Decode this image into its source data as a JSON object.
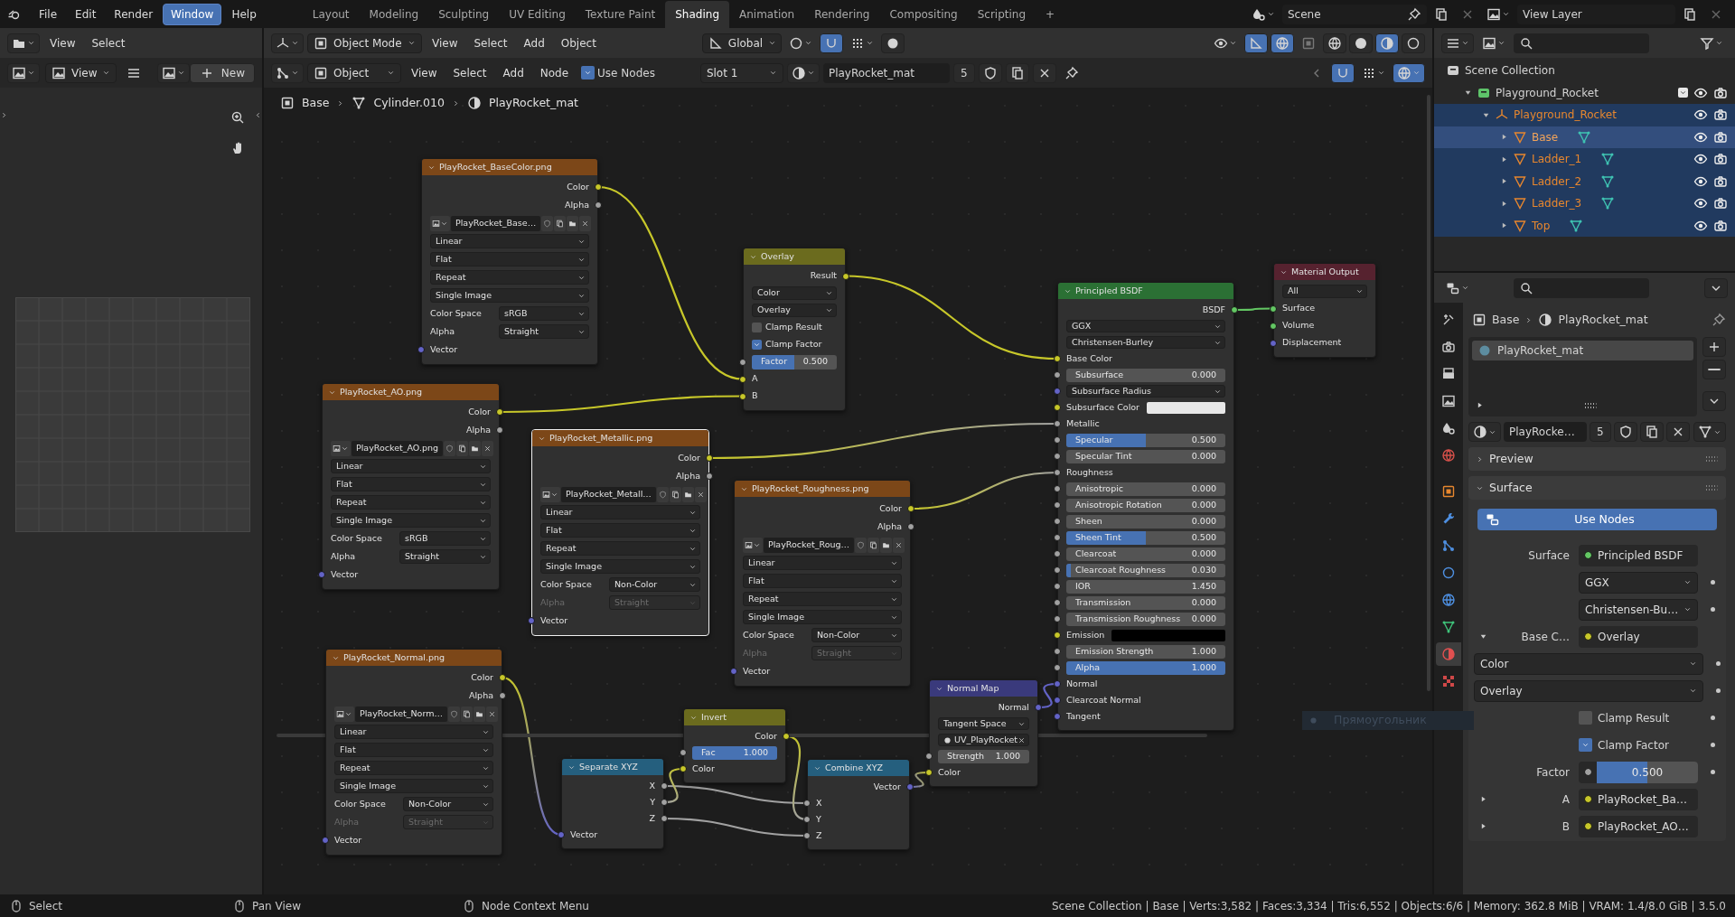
{
  "menu_bar": [
    {
      "label": "File",
      "selected": false
    },
    {
      "label": "Edit",
      "selected": false
    },
    {
      "label": "Render",
      "selected": false
    },
    {
      "label": "Window",
      "selected": true
    },
    {
      "label": "Help",
      "selected": false
    }
  ],
  "workspace_tabs": [
    {
      "label": "Layout",
      "selected": false
    },
    {
      "label": "Modeling",
      "selected": false
    },
    {
      "label": "Sculpting",
      "selected": false
    },
    {
      "label": "UV Editing",
      "selected": false
    },
    {
      "label": "Texture Paint",
      "selected": false
    },
    {
      "label": "Shading",
      "selected": true
    },
    {
      "label": "Animation",
      "selected": false
    },
    {
      "label": "Rendering",
      "selected": false
    },
    {
      "label": "Compositing",
      "selected": false
    },
    {
      "label": "Scripting",
      "selected": false
    }
  ],
  "add_workspace": "+",
  "scene": "Scene",
  "view_layer": "View Layer",
  "image_editor": {
    "menus": [
      "View",
      "Select"
    ],
    "view_menu": "View",
    "new_button": "New"
  },
  "viewport_header": {
    "mode": "Object Mode",
    "menus": [
      "View",
      "Select",
      "Add",
      "Object"
    ],
    "orientation": "Global"
  },
  "node_header": {
    "type": "Object",
    "menus": [
      "View",
      "Select",
      "Add",
      "Node"
    ],
    "use_nodes": {
      "label": "Use Nodes",
      "checked": true
    },
    "slot": "Slot 1",
    "material": "PlayRocket_mat",
    "users": "5"
  },
  "breadcrumb": [
    "Base",
    "Cylinder.010",
    "PlayRocket_mat"
  ],
  "nodes": [
    {
      "kind": "texture",
      "title": "PlayRocket_BaseColor.png",
      "selected": false,
      "rows": [
        {
          "kind": "output",
          "label": "Color",
          "color": "#c7c729"
        },
        {
          "kind": "output",
          "label": "Alpha",
          "color": "#a1a1a1"
        },
        {
          "kind": "image",
          "value": "PlayRocket_Base…"
        },
        {
          "kind": "select",
          "value": "Linear"
        },
        {
          "kind": "select",
          "value": "Flat"
        },
        {
          "kind": "select",
          "value": "Repeat"
        },
        {
          "kind": "select",
          "value": "Single Image"
        },
        {
          "kind": "prop",
          "label": "Color Space",
          "value": "sRGB",
          "disabled": false
        },
        {
          "kind": "prop",
          "label": "Alpha",
          "value": "Straight",
          "disabled": false
        },
        {
          "kind": "input",
          "label": "Vector",
          "color": "#6363c7"
        }
      ]
    },
    {
      "kind": "color",
      "title": "Overlay",
      "selected": false,
      "rows": [
        {
          "kind": "output",
          "label": "Result",
          "color": "#c7c729"
        },
        {
          "kind": "select",
          "value": "Color"
        },
        {
          "kind": "select",
          "value": "Overlay"
        },
        {
          "kind": "check",
          "label": "Clamp Result",
          "checked": false
        },
        {
          "kind": "check",
          "label": "Clamp Factor",
          "checked": true
        },
        {
          "kind": "slider",
          "label": "Factor",
          "value": "0.500",
          "level": 0.5,
          "color": "#a1a1a1"
        },
        {
          "kind": "input",
          "label": "A",
          "color": "#c7c729"
        },
        {
          "kind": "input",
          "label": "B",
          "color": "#c7c729"
        }
      ]
    },
    {
      "kind": "shader",
      "title": "Principled BSDF",
      "selected": false,
      "rows": [
        {
          "kind": "output",
          "label": "BSDF",
          "color": "#63c763"
        },
        {
          "kind": "select",
          "value": "GGX"
        },
        {
          "kind": "select",
          "value": "Christensen-Burley"
        },
        {
          "kind": "input",
          "label": "Base Color",
          "color": "#c7c729"
        },
        {
          "kind": "number",
          "label": "Subsurface",
          "value": "0.000",
          "color": "#a1a1a1"
        },
        {
          "kind": "select",
          "value": "Subsurface Radius",
          "color": "#6363c7"
        },
        {
          "kind": "color",
          "label": "Subsurface Color",
          "swatch": {
            "color": "#e8e8e8"
          },
          "color": "#c7c729"
        },
        {
          "kind": "input",
          "label": "Metallic",
          "color": "#a1a1a1"
        },
        {
          "kind": "slider",
          "label": "Specular",
          "value": "0.500",
          "level": 0.5,
          "color": "#a1a1a1"
        },
        {
          "kind": "number",
          "label": "Specular Tint",
          "value": "0.000",
          "color": "#a1a1a1"
        },
        {
          "kind": "input",
          "label": "Roughness",
          "color": "#a1a1a1"
        },
        {
          "kind": "number",
          "label": "Anisotropic",
          "value": "0.000",
          "color": "#a1a1a1"
        },
        {
          "kind": "number",
          "label": "Anisotropic Rotation",
          "value": "0.000",
          "color": "#a1a1a1"
        },
        {
          "kind": "number",
          "label": "Sheen",
          "value": "0.000",
          "color": "#a1a1a1"
        },
        {
          "kind": "slider",
          "label": "Sheen Tint",
          "value": "0.500",
          "level": 0.5,
          "color": "#a1a1a1"
        },
        {
          "kind": "number",
          "label": "Clearcoat",
          "value": "0.000",
          "color": "#a1a1a1"
        },
        {
          "kind": "slider",
          "label": "Clearcoat Roughness",
          "value": "0.030",
          "level": 0.03,
          "color": "#a1a1a1"
        },
        {
          "kind": "number",
          "label": "IOR",
          "value": "1.450",
          "color": "#a1a1a1"
        },
        {
          "kind": "number",
          "label": "Transmission",
          "value": "0.000",
          "color": "#a1a1a1"
        },
        {
          "kind": "number",
          "label": "Transmission Roughness",
          "value": "0.000",
          "color": "#a1a1a1"
        },
        {
          "kind": "color",
          "label": "Emission",
          "swatch": {
            "color": "#000000"
          },
          "color": "#c7c729"
        },
        {
          "kind": "number",
          "label": "Emission Strength",
          "value": "1.000",
          "color": "#a1a1a1"
        },
        {
          "kind": "slider",
          "label": "Alpha",
          "value": "1.000",
          "level": 1,
          "color": "#a1a1a1"
        },
        {
          "kind": "input",
          "label": "Normal",
          "color": "#6363c7"
        },
        {
          "kind": "input",
          "label": "Clearcoat Normal",
          "color": "#6363c7"
        },
        {
          "kind": "input",
          "label": "Tangent",
          "color": "#6363c7"
        }
      ]
    },
    {
      "kind": "output",
      "title": "Material Output",
      "selected": false,
      "rows": [
        {
          "kind": "select",
          "value": "All"
        },
        {
          "kind": "input",
          "label": "Surface",
          "color": "#63c763"
        },
        {
          "kind": "input",
          "label": "Volume",
          "color": "#63c763"
        },
        {
          "kind": "input",
          "label": "Displacement",
          "color": "#6363c7"
        }
      ]
    },
    {
      "kind": "texture",
      "title": "PlayRocket_AO.png",
      "selected": false,
      "rows": [
        {
          "kind": "output",
          "label": "Color",
          "color": "#c7c729"
        },
        {
          "kind": "output",
          "label": "Alpha",
          "color": "#a1a1a1"
        },
        {
          "kind": "image",
          "value": "PlayRocket_AO.png"
        },
        {
          "kind": "select",
          "value": "Linear"
        },
        {
          "kind": "select",
          "value": "Flat"
        },
        {
          "kind": "select",
          "value": "Repeat"
        },
        {
          "kind": "select",
          "value": "Single Image"
        },
        {
          "kind": "prop",
          "label": "Color Space",
          "value": "sRGB",
          "disabled": false
        },
        {
          "kind": "prop",
          "label": "Alpha",
          "value": "Straight",
          "disabled": false
        },
        {
          "kind": "input",
          "label": "Vector",
          "color": "#6363c7"
        }
      ]
    },
    {
      "kind": "texture",
      "title": "PlayRocket_Metallic.png",
      "selected": true,
      "rows": [
        {
          "kind": "output",
          "label": "Color",
          "color": "#c7c729"
        },
        {
          "kind": "output",
          "label": "Alpha",
          "color": "#a1a1a1"
        },
        {
          "kind": "image",
          "value": "PlayRocket_Metall…"
        },
        {
          "kind": "select",
          "value": "Linear"
        },
        {
          "kind": "select",
          "value": "Flat"
        },
        {
          "kind": "select",
          "value": "Repeat"
        },
        {
          "kind": "select",
          "value": "Single Image"
        },
        {
          "kind": "prop",
          "label": "Color Space",
          "value": "Non-Color",
          "disabled": false
        },
        {
          "kind": "prop",
          "label": "Alpha",
          "value": "Straight",
          "disabled": true
        },
        {
          "kind": "input",
          "label": "Vector",
          "color": "#6363c7"
        }
      ]
    },
    {
      "kind": "texture",
      "title": "PlayRocket_Roughness.png",
      "selected": false,
      "rows": [
        {
          "kind": "output",
          "label": "Color",
          "color": "#c7c729"
        },
        {
          "kind": "output",
          "label": "Alpha",
          "color": "#a1a1a1"
        },
        {
          "kind": "image",
          "value": "PlayRocket_Roug…"
        },
        {
          "kind": "select",
          "value": "Linear"
        },
        {
          "kind": "select",
          "value": "Flat"
        },
        {
          "kind": "select",
          "value": "Repeat"
        },
        {
          "kind": "select",
          "value": "Single Image"
        },
        {
          "kind": "prop",
          "label": "Color Space",
          "value": "Non-Color",
          "disabled": false
        },
        {
          "kind": "prop",
          "label": "Alpha",
          "value": "Straight",
          "disabled": true
        },
        {
          "kind": "input",
          "label": "Vector",
          "color": "#6363c7"
        }
      ]
    },
    {
      "kind": "texture",
      "title": "PlayRocket_Normal.png",
      "selected": false,
      "rows": [
        {
          "kind": "output",
          "label": "Color",
          "color": "#c7c729"
        },
        {
          "kind": "output",
          "label": "Alpha",
          "color": "#a1a1a1"
        },
        {
          "kind": "image",
          "value": "PlayRocket_Norm…"
        },
        {
          "kind": "select",
          "value": "Linear"
        },
        {
          "kind": "select",
          "value": "Flat"
        },
        {
          "kind": "select",
          "value": "Repeat"
        },
        {
          "kind": "select",
          "value": "Single Image"
        },
        {
          "kind": "prop",
          "label": "Color Space",
          "value": "Non-Color",
          "disabled": false
        },
        {
          "kind": "prop",
          "label": "Alpha",
          "value": "Straight",
          "disabled": true
        },
        {
          "kind": "input",
          "label": "Vector",
          "color": "#6363c7"
        }
      ]
    },
    {
      "kind": "converter",
      "title": "Separate XYZ",
      "selected": false,
      "rows": [
        {
          "kind": "output",
          "label": "X",
          "color": "#a1a1a1"
        },
        {
          "kind": "output",
          "label": "Y",
          "color": "#a1a1a1"
        },
        {
          "kind": "output",
          "label": "Z",
          "color": "#a1a1a1"
        },
        {
          "kind": "input",
          "label": "Vector",
          "color": "#6363c7"
        }
      ]
    },
    {
      "kind": "color",
      "title": "Invert",
      "selected": false,
      "rows": [
        {
          "kind": "output",
          "label": "Color",
          "color": "#c7c729"
        },
        {
          "kind": "slider",
          "label": "Fac",
          "value": "1.000",
          "level": 1,
          "color": "#a1a1a1"
        },
        {
          "kind": "input",
          "label": "Color",
          "color": "#c7c729"
        }
      ]
    },
    {
      "kind": "converter",
      "title": "Combine XYZ",
      "selected": false,
      "rows": [
        {
          "kind": "output",
          "label": "Vector",
          "color": "#6363c7"
        },
        {
          "kind": "input",
          "label": "X",
          "color": "#a1a1a1"
        },
        {
          "kind": "input",
          "label": "Y",
          "color": "#a1a1a1"
        },
        {
          "kind": "input",
          "label": "Z",
          "color": "#a1a1a1"
        }
      ]
    },
    {
      "kind": "vector",
      "title": "Normal Map",
      "selected": false,
      "rows": [
        {
          "kind": "output",
          "label": "Normal",
          "color": "#6363c7"
        },
        {
          "kind": "select",
          "value": "Tangent Space"
        },
        {
          "kind": "field",
          "value": "UV_PlayRocket"
        },
        {
          "kind": "number",
          "label": "Strength",
          "value": "1.000",
          "color": "#a1a1a1"
        },
        {
          "kind": "input",
          "label": "Color",
          "color": "#c7c729"
        }
      ]
    }
  ],
  "ghost_label": "Прямоугольник",
  "outliner": [
    {
      "label": "Scene Collection",
      "kind": "scene",
      "selected": false,
      "active": false,
      "children": [
        {
          "label": "Playground_Rocket",
          "kind": "collection",
          "selected": false,
          "active": false,
          "expanded": true,
          "checked": true,
          "children": [
            {
              "label": "Playground_Rocket",
              "kind": "empty",
              "selected": true,
              "active": false,
              "expanded": true,
              "children": [
                {
                  "label": "Base",
                  "kind": "mesh",
                  "selected": true,
                  "active": true,
                  "expanded": false
                },
                {
                  "label": "Ladder_1",
                  "kind": "mesh",
                  "selected": true,
                  "active": false,
                  "expanded": false
                },
                {
                  "label": "Ladder_2",
                  "kind": "mesh",
                  "selected": true,
                  "active": false,
                  "expanded": false
                },
                {
                  "label": "Ladder_3",
                  "kind": "mesh",
                  "selected": true,
                  "active": false,
                  "expanded": false
                },
                {
                  "label": "Top",
                  "kind": "mesh",
                  "selected": true,
                  "active": false,
                  "expanded": false
                }
              ]
            }
          ]
        }
      ]
    }
  ],
  "property_tabs": [
    {
      "selected": false
    },
    {
      "selected": false
    },
    {
      "selected": false
    },
    {
      "selected": false
    },
    {
      "selected": false
    },
    {
      "selected": false
    },
    {
      "selected": false
    },
    {
      "selected": false
    },
    {
      "selected": false
    },
    {
      "selected": false
    },
    {
      "selected": false
    },
    {
      "selected": false
    },
    {
      "selected": true
    },
    {
      "selected": false
    }
  ],
  "properties": {
    "breadcrumb": [
      "Base",
      "PlayRocket_mat"
    ],
    "material_slots": [
      {
        "label": "PlayRocket_mat",
        "selected": true
      }
    ],
    "material": "PlayRocke…",
    "users": "5",
    "panels": [
      {
        "title": "Preview",
        "expanded": false
      },
      {
        "title": "Surface",
        "expanded": true
      }
    ],
    "use_nodes": "Use Nodes",
    "rows": [
      {
        "kind": "link",
        "label": "Surface",
        "value": "Principled BSDF",
        "color": "#63c763"
      },
      {
        "kind": "select",
        "value": "GGX"
      },
      {
        "kind": "select",
        "value": "Christensen-Bu…"
      },
      {
        "kind": "link",
        "label": "Base C…",
        "value": "Overlay",
        "color": "#c7c729",
        "expanded": true
      },
      {
        "kind": "wide_select",
        "value": "Color"
      },
      {
        "kind": "wide_select",
        "value": "Overlay"
      },
      {
        "kind": "check",
        "label": "Clamp Result",
        "checked": false
      },
      {
        "kind": "check",
        "label": "Clamp Factor",
        "checked": true
      },
      {
        "kind": "slider",
        "label": "Factor",
        "value": "0.500",
        "level": 0.5,
        "color": "#a1a1a1"
      },
      {
        "kind": "link",
        "label": "A",
        "value": "PlayRocket_Ba…",
        "color": "#c7c729",
        "expanded": false
      },
      {
        "kind": "link",
        "label": "B",
        "value": "PlayRocket_AO…",
        "color": "#c7c729",
        "expanded": false
      }
    ]
  },
  "status_bar": {
    "hints": [
      "Select",
      "Pan View",
      "Node Context Menu"
    ],
    "stats": "Scene Collection | Base | Verts:3,582 | Faces:3,334 | Tris:6,552 | Objects:6/6 | Memory: 362.8 MiB | VRAM: 1.4/8.0 GiB | 3.5.0"
  }
}
